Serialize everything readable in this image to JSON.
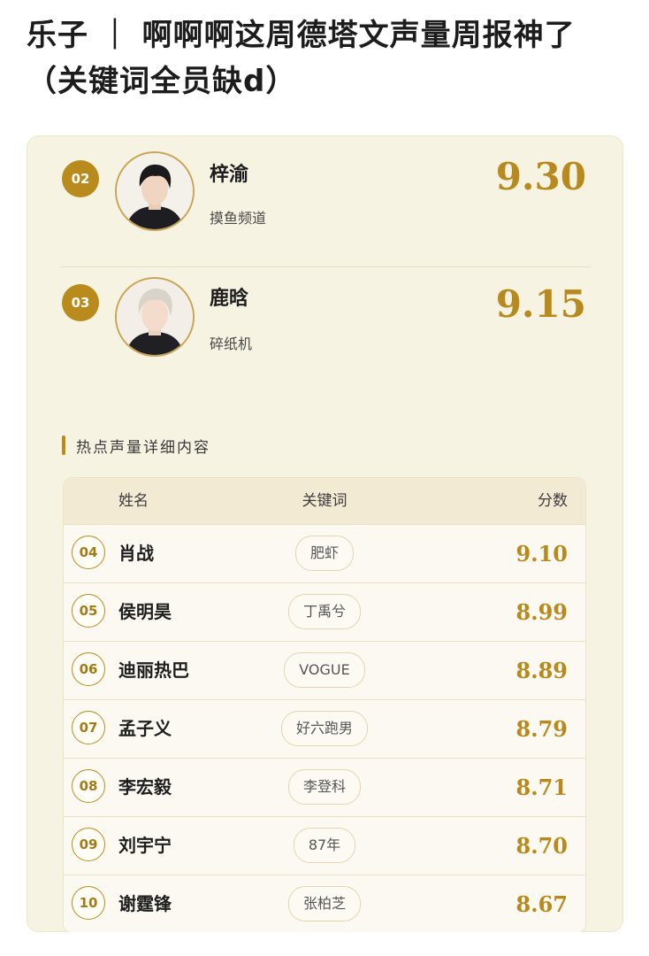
{
  "post": {
    "title": "乐子 ｜ 啊啊啊这周德塔文声量周报神了（关键词全员缺d）"
  },
  "top_entries": [
    {
      "rank": "02",
      "name": "梓渝",
      "keyword": "摸鱼频道",
      "score": "9.30"
    },
    {
      "rank": "03",
      "name": "鹿晗",
      "keyword": "碎纸机",
      "score": "9.15"
    }
  ],
  "section": {
    "title": "热点声量详细内容"
  },
  "table": {
    "headers": {
      "name": "姓名",
      "keyword": "关键词",
      "score": "分数"
    },
    "rows": [
      {
        "rank": "04",
        "name": "肖战",
        "keyword": "肥虾",
        "score": "9.10"
      },
      {
        "rank": "05",
        "name": "侯明昊",
        "keyword": "丁禹兮",
        "score": "8.99"
      },
      {
        "rank": "06",
        "name": "迪丽热巴",
        "keyword": "VOGUE",
        "score": "8.89"
      },
      {
        "rank": "07",
        "name": "孟子义",
        "keyword": "好六跑男",
        "score": "8.79"
      },
      {
        "rank": "08",
        "name": "李宏毅",
        "keyword": "李登科",
        "score": "8.71"
      },
      {
        "rank": "09",
        "name": "刘宇宁",
        "keyword": "87年",
        "score": "8.70"
      },
      {
        "rank": "10",
        "name": "谢霆锋",
        "keyword": "张柏芝",
        "score": "8.67"
      }
    ]
  },
  "colors": {
    "accent_gold": "#b98b1d",
    "card_background": "#f7f3e3"
  }
}
